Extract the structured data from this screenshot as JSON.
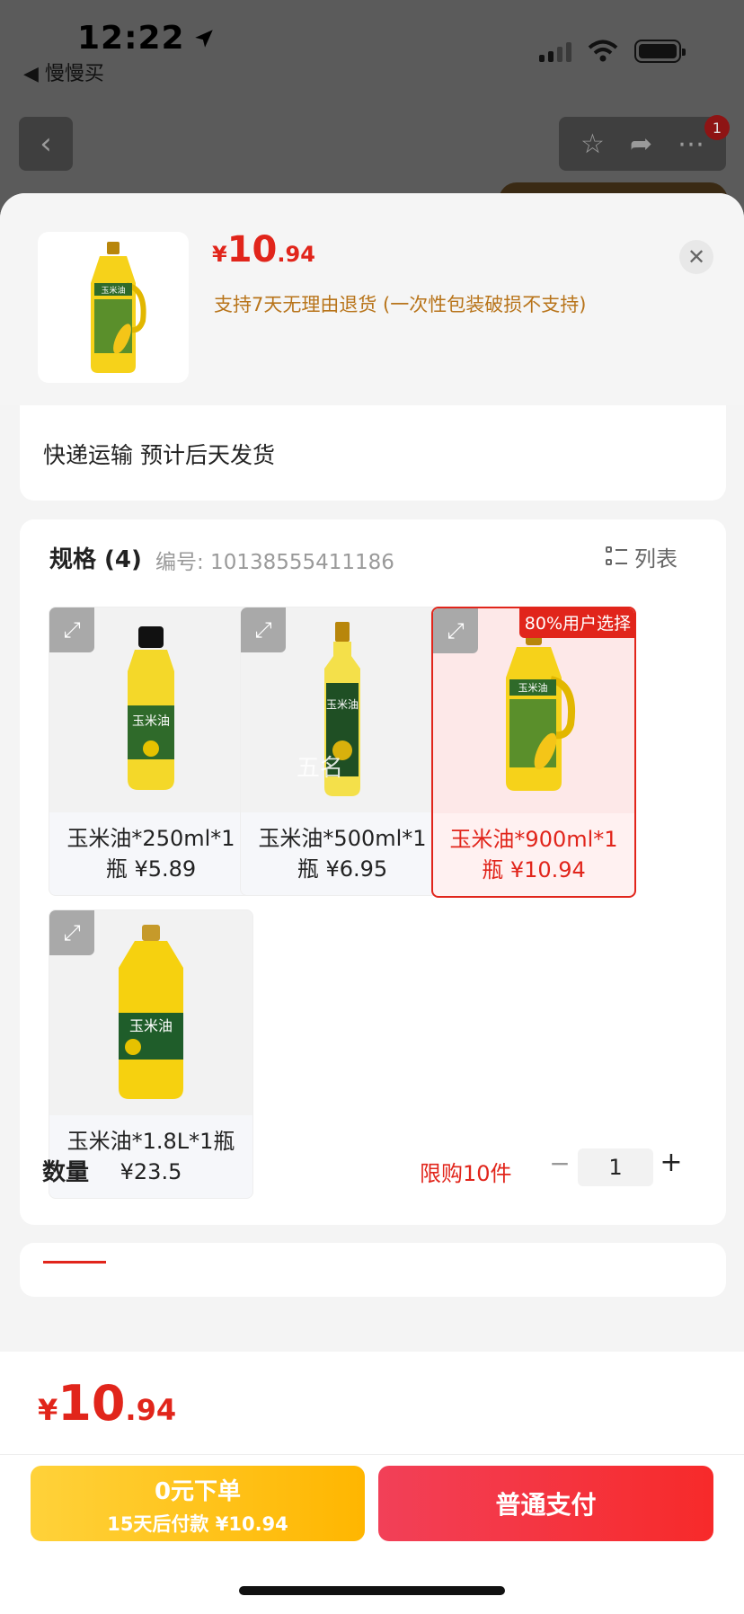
{
  "status_bar": {
    "time": "12:22",
    "back_app": "◀ 慢慢买"
  },
  "nav": {
    "notification_count": "1"
  },
  "header": {
    "price": {
      "currency": "¥",
      "integer": "10",
      "decimal": ".94"
    },
    "policy": "支持7天无理由退货 (一次性包装破损不支持)"
  },
  "shipping": {
    "text": "快递运输  预计后天发货"
  },
  "spec": {
    "title": "规格 (4)",
    "code": "编号: 10138555411186",
    "list_toggle": "列表",
    "options": [
      {
        "label": "玉米油*250ml*1瓶 ¥5.89",
        "selected": false
      },
      {
        "label": "玉米油*500ml*1瓶 ¥6.95",
        "selected": false
      },
      {
        "label": "玉米油*900ml*1瓶 ¥10.94",
        "selected": true,
        "badge": "80%用户选择"
      },
      {
        "label": "玉米油*1.8L*1瓶 ¥23.5",
        "selected": false
      }
    ],
    "bottle_label": "玉米油",
    "watermark": "五名"
  },
  "quantity": {
    "label": "数量",
    "limit": "限购10件",
    "value": "1",
    "minus": "−",
    "plus": "+"
  },
  "footer": {
    "price": {
      "currency": "¥",
      "integer": "10",
      "decimal": ".94"
    },
    "later_btn_line1": "0元下单",
    "later_btn_line2": "15天后付款 ¥10.94",
    "pay_btn": "普通支付"
  },
  "colors": {
    "accent": "#e1251b",
    "policy": "#b8741a",
    "later_btn": "#ffc21a"
  }
}
